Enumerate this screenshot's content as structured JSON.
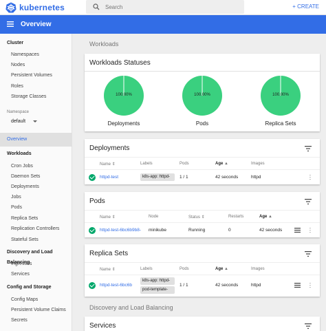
{
  "app": {
    "brand": "kubernetes",
    "create_label": "CREATE"
  },
  "search": {
    "placeholder": "Search"
  },
  "header": {
    "title": "Overview"
  },
  "sidebar": {
    "cluster_head": "Cluster",
    "cluster_items": [
      "Namespaces",
      "Nodes",
      "Persistent Volumes",
      "Roles",
      "Storage Classes"
    ],
    "namespace_label": "Namespace",
    "namespace_value": "default",
    "overview": "Overview",
    "workloads_head": "Workloads",
    "workloads_items": [
      "Cron Jobs",
      "Daemon Sets",
      "Deployments",
      "Jobs",
      "Pods",
      "Replica Sets",
      "Replication Controllers",
      "Stateful Sets"
    ],
    "discovery_head": "Discovery and Load Balancing",
    "discovery_items": [
      "Ingresses",
      "Services"
    ],
    "config_head": "Config and Storage",
    "config_items": [
      "Config Maps",
      "Persistent Volume Claims",
      "Secrets"
    ]
  },
  "main": {
    "workloads_title": "Workloads",
    "statuses": {
      "title": "Workloads Statuses",
      "items": [
        {
          "label": "Deployments",
          "percent": "100.00%",
          "value": 100
        },
        {
          "label": "Pods",
          "percent": "100.00%",
          "value": 100
        },
        {
          "label": "Replica Sets",
          "percent": "100.00%",
          "value": 100
        }
      ]
    },
    "deployments": {
      "title": "Deployments",
      "headers": [
        "Name",
        "Labels",
        "Pods",
        "Age",
        "Images"
      ],
      "row": {
        "name": "httpd-test",
        "label": "k8s-app: httpd-",
        "pods": "1 / 1",
        "age": "42 seconds",
        "image": "httpd"
      }
    },
    "pods": {
      "title": "Pods",
      "headers": [
        "Name",
        "Node",
        "Status",
        "Restarts",
        "Age"
      ],
      "row": {
        "name": "httpd-test-6bc6b9b8-",
        "node": "minikube",
        "status": "Running",
        "restarts": "0",
        "age": "42 seconds"
      }
    },
    "replica_sets": {
      "title": "Replica Sets",
      "headers": [
        "Name",
        "Labels",
        "Pods",
        "Age",
        "Images"
      ],
      "row": {
        "name": "httpd-test-6bc6b",
        "label1": "k8s-app: httpd-",
        "label2": "pod-template-",
        "pods": "1 / 1",
        "age": "42 seconds",
        "image": "httpd"
      }
    },
    "discovery_title": "Discovery and Load Balancing",
    "services": {
      "title": "Services"
    }
  },
  "colors": {
    "accent": "#326de6",
    "success": "#00a86b",
    "donut": "#3ad07f"
  }
}
